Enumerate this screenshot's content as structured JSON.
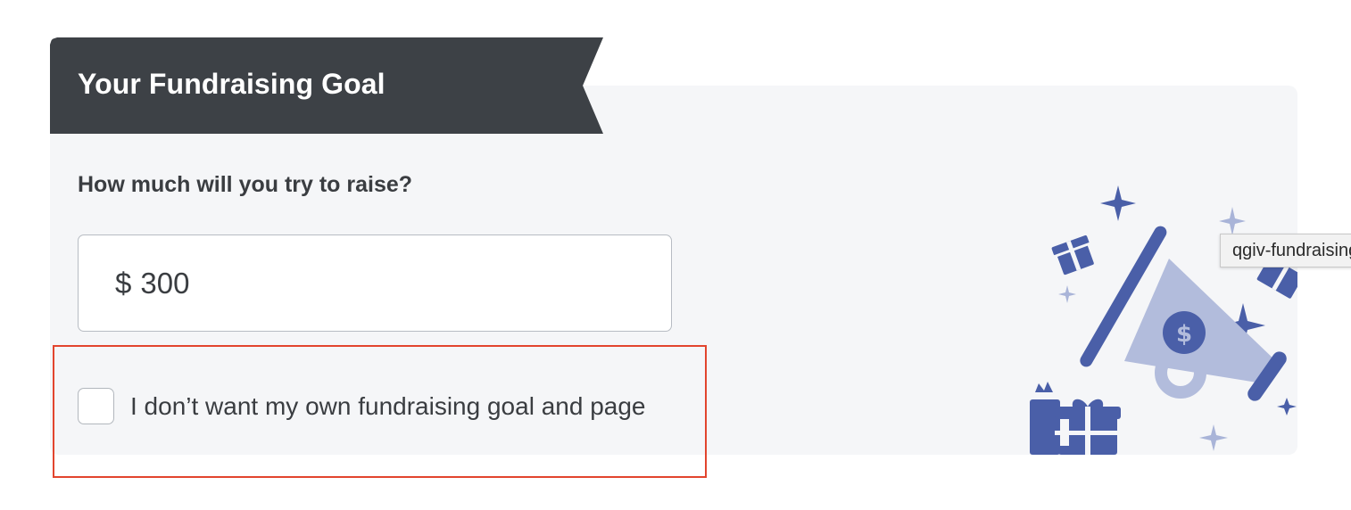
{
  "section": {
    "title": "Your Fundraising Goal",
    "question": "How much will you try to raise?"
  },
  "goal_input": {
    "currency_symbol": "$",
    "value": "300"
  },
  "opt_out": {
    "label": "I don’t want my own fundraising goal and page",
    "checked": false
  },
  "tooltip": {
    "text": "qgiv-fundraising"
  },
  "illustration": {
    "icons": [
      "megaphone-icon",
      "dollar-coin-icon",
      "gift-icon",
      "sparkle-icon"
    ],
    "colors": {
      "primary": "#4a5fa8",
      "light": "#b2bcdc",
      "star_light": "#a9b4d8"
    }
  },
  "colors": {
    "banner_bg": "#3d4146",
    "panel_bg": "#f5f6f8",
    "highlight_border": "#e2452e",
    "text": "#3a3d41"
  }
}
